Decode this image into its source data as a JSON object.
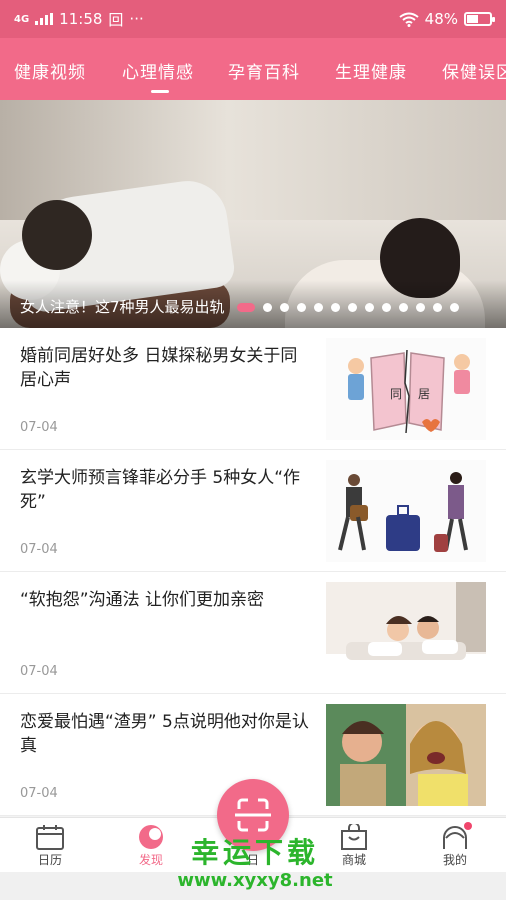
{
  "status": {
    "network": "4G",
    "time": "11:58",
    "sim_badge": "回",
    "more": "···",
    "battery": "48%"
  },
  "tabs": [
    {
      "label": "健康视频"
    },
    {
      "label": "心理情感"
    },
    {
      "label": "孕育百科"
    },
    {
      "label": "生理健康"
    },
    {
      "label": "保健误区"
    }
  ],
  "banner": {
    "title": "女人注意！这7种男人最易出轨",
    "page_count": 13,
    "active_page": 0
  },
  "articles": [
    {
      "title": "婚前同居好处多 日媒探秘男女关于同居心声",
      "date": "07-04",
      "thumb_text_1": "同",
      "thumb_text_2": "居"
    },
    {
      "title": "玄学大师预言锋菲必分手 5种女人“作死”",
      "date": "07-04"
    },
    {
      "title": "“软抱怨”沟通法 让你们更加亲密",
      "date": "07-04"
    },
    {
      "title": "恋爱最怕遇“渣男” 5点说明他对你是认真",
      "date": "07-04"
    }
  ],
  "nav": [
    {
      "label": "日历",
      "icon": "calendar-icon"
    },
    {
      "label": "发现",
      "icon": "discover-icon"
    },
    {
      "label": "日",
      "icon": "scan-icon"
    },
    {
      "label": "商城",
      "icon": "shopping-bag-icon"
    },
    {
      "label": "我的",
      "icon": "profile-icon"
    }
  ],
  "watermark": {
    "text": "幸运下载",
    "url": "www.xyxy8.net"
  },
  "colors": {
    "accent": "#f26a89",
    "status_bar": "#e45e7c",
    "watermark": "#2cb52c"
  }
}
